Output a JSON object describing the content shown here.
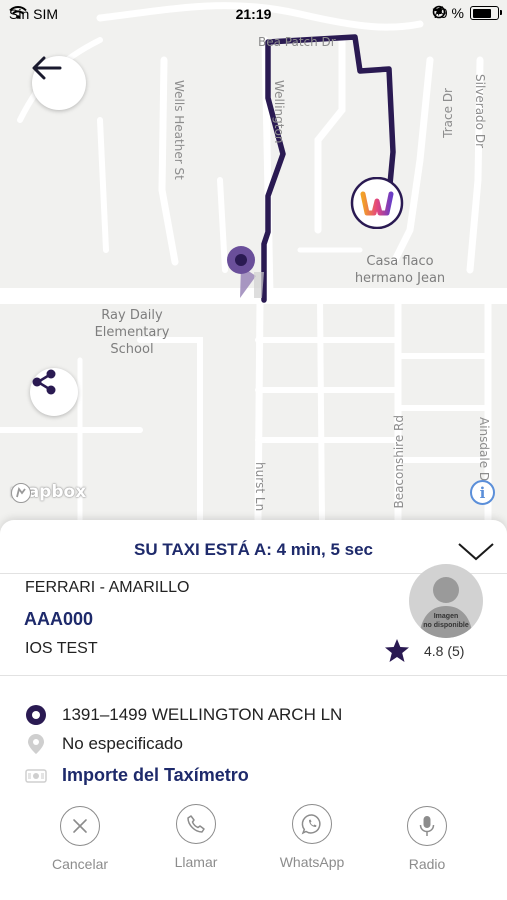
{
  "status_bar": {
    "carrier": "Sin SIM",
    "time": "21:19",
    "battery": "79 %",
    "battery_level": 0.79
  },
  "map": {
    "streets": {
      "wells_heather": "Wells Heather St",
      "wellington": "Wellington",
      "bea_patch": "Bea Patch Dr",
      "trace": "Trace Dr",
      "silverado": "Silverado Dr",
      "hurst": "hurst Ln",
      "beaconshire": "Beaconshire Rd",
      "ainsdale": "Ainsdale Dr"
    },
    "pois": {
      "school_line1": "Ray Daily Elementary",
      "school_line2": "School",
      "house_line1": "Casa flaco",
      "house_line2": "hermano Jean"
    },
    "attribution": "mapbox",
    "info_glyph": "i",
    "route_color": "#2a1a52",
    "back_icon": "arrow-left-icon",
    "share_icon": "share-icon"
  },
  "trip": {
    "eta_text": "SU TAXI ESTÁ A: 4 min, 5 sec",
    "car_model": "FERRARI - AMARILLO",
    "plate": "AAA000",
    "driver_name": "IOS TEST",
    "photo_caption_line1": "Imagen",
    "photo_caption_line2": "no disponible",
    "rating": "4.8 (5)",
    "origin": "1391–1499 WELLINGTON ARCH LN",
    "destination": "No especificado",
    "meter_label": "Importe del Taxímetro"
  },
  "actions": {
    "cancel": "Cancelar",
    "call": "Llamar",
    "whatsapp": "WhatsApp",
    "radio": "Radio"
  },
  "colors": {
    "brand_navy": "#1e2a6b",
    "route": "#2a1a52",
    "icon_grey": "#8c8c8c"
  }
}
